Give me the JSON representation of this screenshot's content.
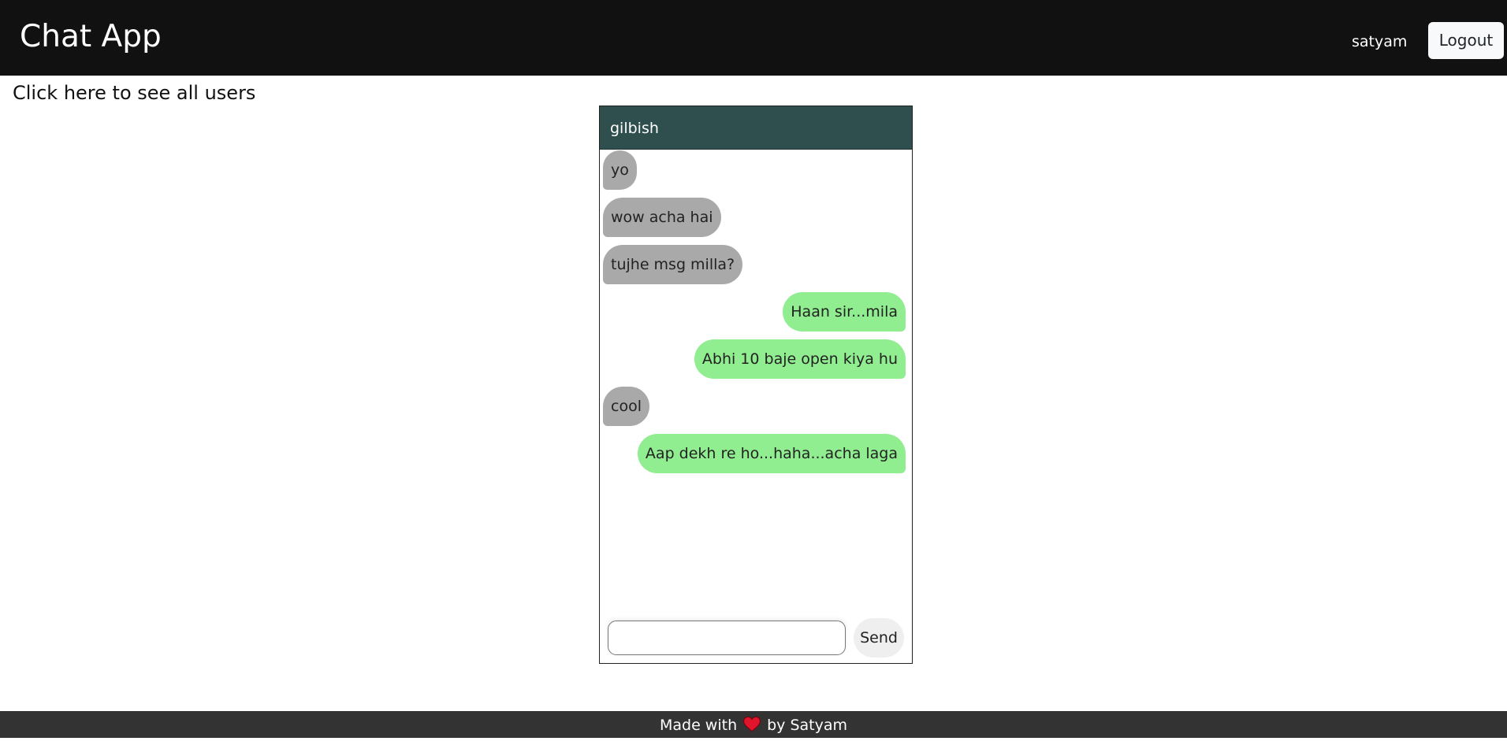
{
  "navbar": {
    "brand": "Chat App",
    "username": "satyam",
    "logout_label": "Logout"
  },
  "links": {
    "all_users": "Click here to see all users"
  },
  "chat": {
    "contact_name": "gilbish",
    "messages": [
      {
        "direction": "incoming",
        "text": "yo"
      },
      {
        "direction": "incoming",
        "text": "wow acha hai"
      },
      {
        "direction": "incoming",
        "text": "tujhe msg milla?"
      },
      {
        "direction": "outgoing",
        "text": "Haan sir...mila"
      },
      {
        "direction": "outgoing",
        "text": "Abhi 10 baje open kiya hu"
      },
      {
        "direction": "incoming",
        "text": "cool"
      },
      {
        "direction": "outgoing",
        "text": "Aap dekh re ho...haha...acha laga"
      }
    ],
    "input_value": "",
    "send_label": "Send"
  },
  "footer": {
    "prefix": "Made with",
    "icon": "heart-icon",
    "suffix": "by Satyam"
  },
  "colors": {
    "navbar_bg": "#111111",
    "chat_header_bg": "#2f4f4f",
    "incoming_bubble": "#a9a9a9",
    "outgoing_bubble": "#90ee90",
    "footer_bg": "#333333",
    "heart": "#e0142a"
  }
}
